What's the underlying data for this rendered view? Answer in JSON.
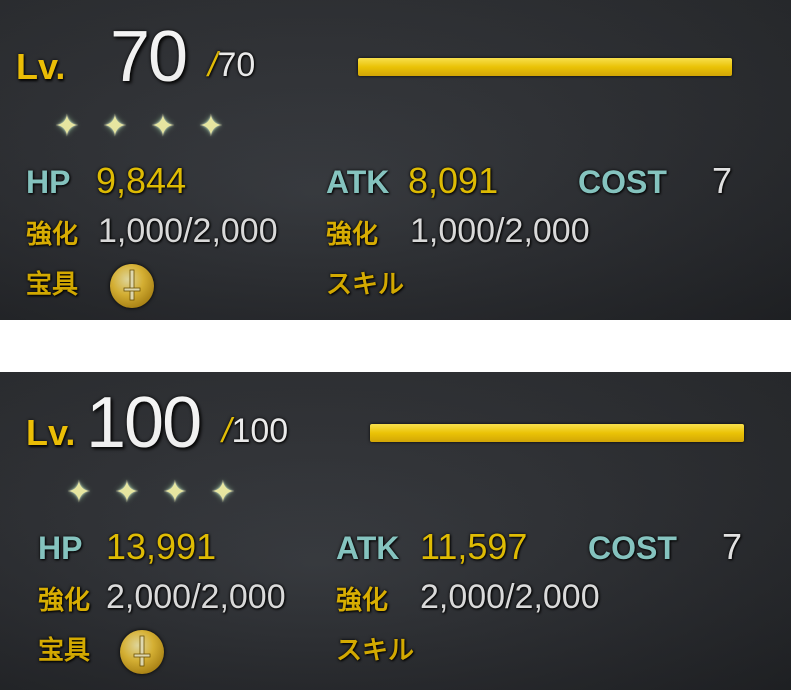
{
  "panels": [
    {
      "level_label": "Lv.",
      "level": "70",
      "level_max": "/70",
      "level_slash": "/",
      "level_max_num": "70",
      "level_progress": 1.0,
      "stars": 4,
      "hp_label": "HP",
      "hp_value": "9,844",
      "atk_label": "ATK",
      "atk_value": "8,091",
      "cost_label": "COST",
      "cost_value": "7",
      "fou_label": "強化",
      "hp_fou": "1,000/2,000",
      "atk_fou_label": "強化",
      "atk_fou": "1,000/2,000",
      "np_label": "宝具",
      "np_icon": "sword-card-icon",
      "skill_label": "スキル"
    },
    {
      "level_label": "Lv.",
      "level": "100",
      "level_max": "/100",
      "level_slash": "/",
      "level_max_num": "100",
      "level_progress": 1.0,
      "stars": 4,
      "hp_label": "HP",
      "hp_value": "13,991",
      "atk_label": "ATK",
      "atk_value": "11,597",
      "cost_label": "COST",
      "cost_value": "7",
      "fou_label": "強化",
      "hp_fou": "2,000/2,000",
      "atk_fou_label": "強化",
      "atk_fou": "2,000/2,000",
      "np_label": "宝具",
      "np_icon": "sword-card-icon",
      "skill_label": "スキル"
    }
  ],
  "colors": {
    "accent_yellow": "#f2c200",
    "stat_label": "#8fd4cf",
    "star": "#f4f3a8"
  }
}
